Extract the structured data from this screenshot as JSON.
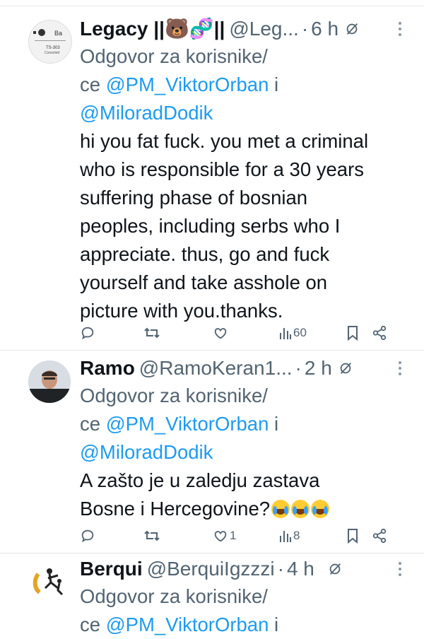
{
  "tweets": [
    {
      "name": "Legacy ||🐻🧬||",
      "handle": "@Leg...",
      "time": "6 h",
      "reply_prefix": "Odgovor za korisnike/",
      "reply_line2_prefix": "ce ",
      "mention1": "@PM_ViktorOrban",
      "conj": " i",
      "mention2": "@MiloradDodik",
      "text": "hi you fat fuck. you met a criminal\nwho is responsible for a 30 years\nsuffering phase of bosnian\npeoples, including serbs who I\nappreciate. thus, go and fuck\nyourself and take asshole on\npicture with you.thanks.",
      "avatar_label_top": "Ba",
      "avatar_label_mid": "TS-303",
      "avatar_label_bot": "Consoled",
      "likes": "",
      "views": "60"
    },
    {
      "name": "Ramo",
      "handle": "@RamoKeran1...",
      "time": "2 h",
      "reply_prefix": "Odgovor za korisnike/",
      "reply_line2_prefix": "ce ",
      "mention1": "@PM_ViktorOrban",
      "conj": " i",
      "mention2": "@MiloradDodik",
      "text_line1": "A zašto je u zaledju zastava",
      "text_line2": "Bosne i Hercegovine?",
      "likes": "1",
      "views": "8"
    },
    {
      "name": "Berqui",
      "handle": "@BerquiIgzzzi",
      "time": "4 h",
      "reply_prefix": "Odgovor za korisnike/",
      "reply_line2_prefix": "ce ",
      "mention1": "@PM_ViktorOrban",
      "conj": " i"
    }
  ],
  "icons": {
    "reply": "reply-icon",
    "retweet": "retweet-icon",
    "like": "like-icon",
    "views": "views-icon",
    "bookmark": "bookmark-icon",
    "share": "share-icon",
    "grok": "grok-icon",
    "more": "more-icon"
  },
  "colors": {
    "text": "#0f1419",
    "secondary": "#536471",
    "link": "#1d9bf0",
    "divider": "#e1e4e8"
  }
}
